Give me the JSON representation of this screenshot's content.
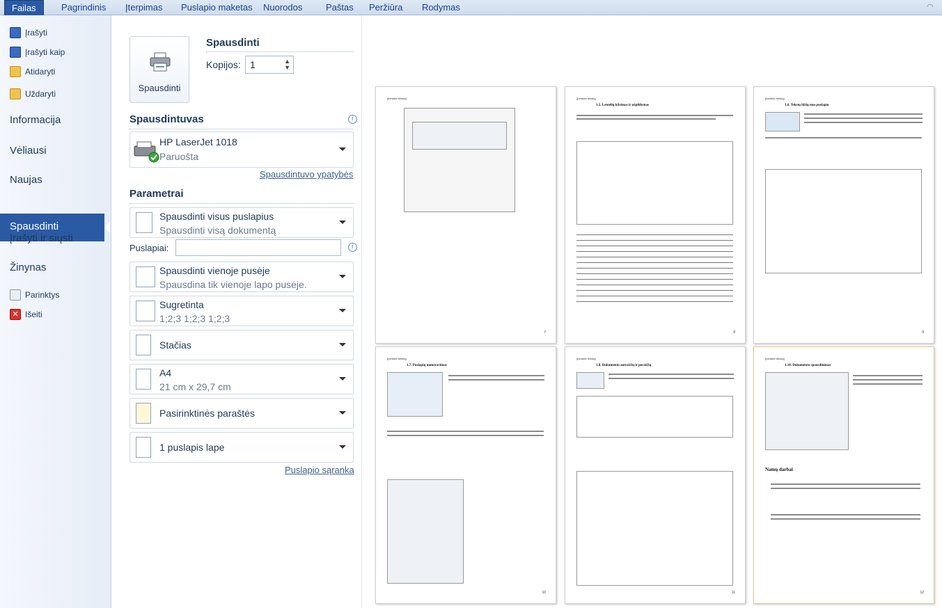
{
  "ribbon": {
    "tabs": [
      "Failas",
      "Pagrindinis",
      "Įterpimas",
      "Puslapio maketas",
      "Nuorodos",
      "Paštas",
      "Peržiūra",
      "Rodymas"
    ],
    "active_tab": "Failas"
  },
  "nav": {
    "save": "Įrašyti",
    "save_as": "Įrašyti kaip",
    "open": "Atidaryti",
    "close": "Uždaryti",
    "info": "Informacija",
    "recent": "Vėliausi",
    "new": "Naujas",
    "print": "Spausdinti",
    "save_send": "Įrašyti ir siųsti",
    "help": "Žinynas",
    "options": "Parinktys",
    "exit": "Išeiti"
  },
  "print": {
    "title": "Spausdinti",
    "button_label": "Spausdinti",
    "copies_label": "Kopijos:",
    "copies_value": "1"
  },
  "printer": {
    "section": "Spausdintuvas",
    "name": "HP LaserJet 1018",
    "status": "Paruošta",
    "properties_link": "Spausdintuvo ypatybės"
  },
  "settings": {
    "section": "Parametrai",
    "pages_label": "Puslapiai:",
    "pages_value": "",
    "range": {
      "l1": "Spausdinti visus puslapius",
      "l2": "Spausdinti visą dokumentą"
    },
    "sides": {
      "l1": "Spausdinti vienoje pusėje",
      "l2": "Spausdina tik vienoje lapo pusėje."
    },
    "collate": {
      "l1": "Sugretinta",
      "l2": "1;2;3   1;2;3   1;2;3"
    },
    "orientation": {
      "l1": "Stačias"
    },
    "paper": {
      "l1": "A4",
      "l2": "21 cm x 29,7 cm"
    },
    "margins": {
      "l1": "Pasirinktinės paraštės"
    },
    "per_sheet": {
      "l1": "1 puslapis lape"
    },
    "page_setup_link": "Puslapio sąranka"
  },
  "preview": {
    "header_text": "[Įveskite tekstą]",
    "pages": [
      {
        "number": "7",
        "title": ""
      },
      {
        "number": "8",
        "title": "1.5. Lentelių kūrimas ir užpildymas"
      },
      {
        "number": "9",
        "title": "1.6. Tekstų lūžių nuo puslapio"
      },
      {
        "number": "10",
        "title": "1.7. Puslapių numeravimas"
      },
      {
        "number": "11",
        "title": "1.8. Dokumento antraščių ir poraščių"
      },
      {
        "number": "12",
        "title": "1.10. Dokumento spausdinimas",
        "extra": "Namų darbai"
      }
    ]
  },
  "colors": {
    "accent": "#2a5aa3",
    "nav_bg": "#e6edf7"
  }
}
